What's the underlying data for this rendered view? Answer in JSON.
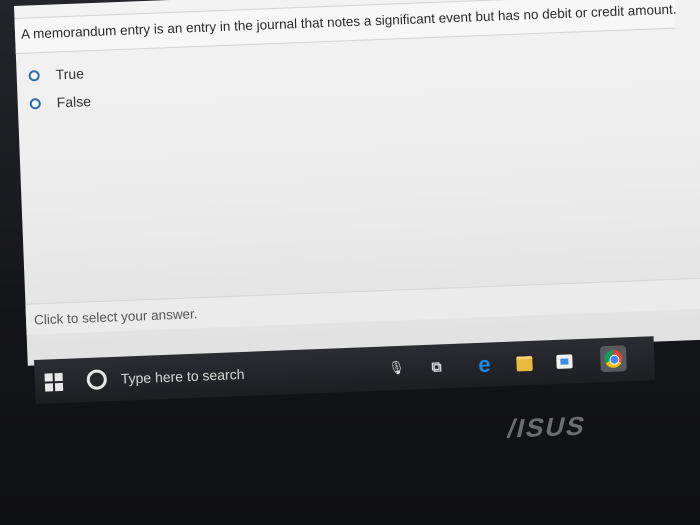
{
  "question": {
    "text": "A memorandum entry is an entry in the journal that notes a significant event but has no debit or credit amount."
  },
  "options": [
    {
      "label": "True"
    },
    {
      "label": "False"
    }
  ],
  "hint": {
    "text": "Click to select your answer."
  },
  "taskbar": {
    "search_placeholder": "Type here to search",
    "icons": [
      "windows-start-icon",
      "cortana-icon",
      "microphone-icon",
      "task-view-icon",
      "edge-icon",
      "file-explorer-icon",
      "store-icon",
      "chrome-icon"
    ]
  },
  "laptop": {
    "brand": "/ISUS"
  },
  "colors": {
    "radio_accent": "#2b6cb0",
    "taskbar": "#1c1e22",
    "edge": "#1e88e5"
  }
}
